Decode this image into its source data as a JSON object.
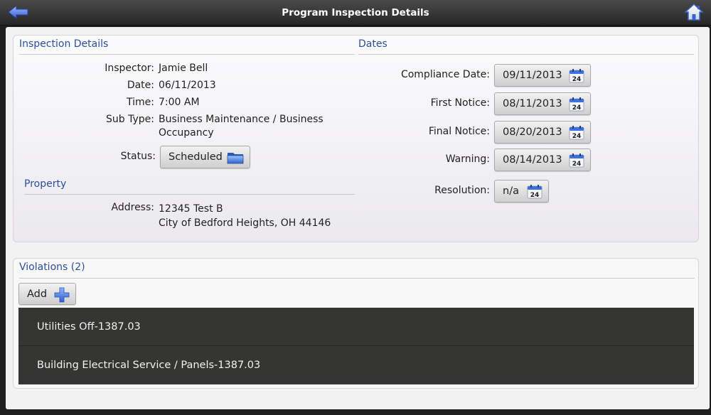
{
  "header": {
    "title": "Program Inspection Details"
  },
  "inspection": {
    "section_title": "Inspection Details",
    "inspector_label": "Inspector:",
    "inspector_value": "Jamie Bell",
    "date_label": "Date:",
    "date_value": "06/11/2013",
    "time_label": "Time:",
    "time_value": "7:00 AM",
    "subtype_label": "Sub Type:",
    "subtype_line1": "Business Maintenance / Business",
    "subtype_line2": "Occupancy",
    "status_label": "Status:",
    "status_value": "Scheduled"
  },
  "property": {
    "section_title": "Property",
    "address_label": "Address:",
    "address_line1": "12345 Test B",
    "address_line2": "City of Bedford Heights, OH 44146"
  },
  "dates": {
    "section_title": "Dates",
    "items": [
      {
        "label": "Compliance Date:",
        "value": "09/11/2013"
      },
      {
        "label": "First Notice:",
        "value": "08/11/2013"
      },
      {
        "label": "Final Notice:",
        "value": "08/20/2013"
      },
      {
        "label": "Warning:",
        "value": "08/14/2013"
      },
      {
        "label": "Resolution:",
        "value": "n/a"
      }
    ],
    "calendar_day": "24"
  },
  "violations": {
    "section_title": "Violations (2)",
    "add_label": "Add",
    "items": [
      {
        "label": "Utilities Off-1387.03"
      },
      {
        "label": "Building Electrical  Service / Panels-1387.03"
      }
    ]
  },
  "colors": {
    "accent": "#2d4f9e",
    "list_background": "#353633"
  },
  "icons": {
    "back": "back-arrow-icon",
    "home": "home-icon",
    "status": "folder-icon",
    "date": "calendar-icon",
    "add": "plus-icon"
  }
}
